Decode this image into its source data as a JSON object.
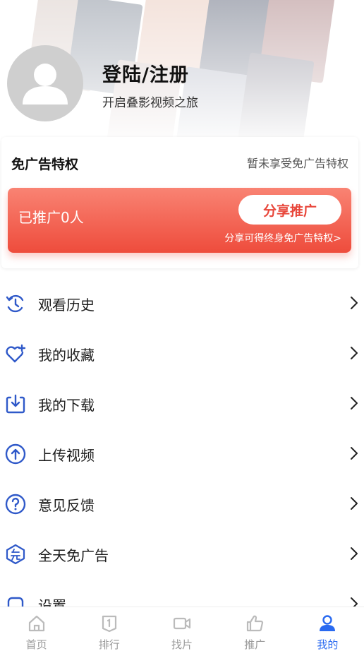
{
  "profile": {
    "login_label": "登陆/注册",
    "subtitle": "开启叠影视频之旅"
  },
  "ad_card": {
    "title": "免广告特权",
    "status": "暂未享受免广告特权",
    "promo_count": "已推广0人",
    "share_button": "分享推广",
    "note": "分享可得终身免广告特权>"
  },
  "menu": {
    "items": [
      {
        "label": "观看历史",
        "icon": "history-icon"
      },
      {
        "label": "我的收藏",
        "icon": "heart-plus-icon"
      },
      {
        "label": "我的下载",
        "icon": "download-icon"
      },
      {
        "label": "上传视频",
        "icon": "upload-icon"
      },
      {
        "label": "意见反馈",
        "icon": "question-icon"
      },
      {
        "label": "全天免广告",
        "icon": "ad-free-icon"
      },
      {
        "label": "设置",
        "icon": "settings-icon"
      }
    ]
  },
  "bottom_nav": {
    "tabs": [
      {
        "label": "首页",
        "icon": "home-icon"
      },
      {
        "label": "排行",
        "icon": "ranking-icon"
      },
      {
        "label": "找片",
        "icon": "video-camera-icon"
      },
      {
        "label": "推广",
        "icon": "thumbs-up-icon"
      },
      {
        "label": "我的",
        "icon": "user-icon"
      }
    ],
    "active_tab": "我的"
  },
  "colors": {
    "accent": "#2a6af0",
    "promo_red": "#ee4c3c",
    "icon_blue": "#2f59c9"
  }
}
